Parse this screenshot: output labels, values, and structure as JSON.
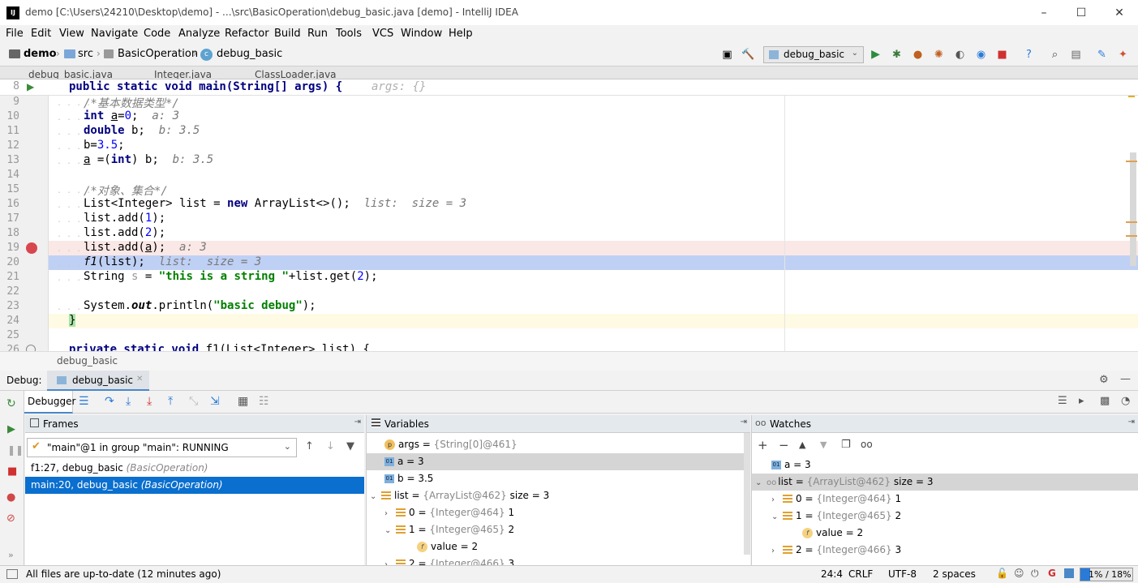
{
  "window": {
    "title": "demo [C:\\Users\\24210\\Desktop\\demo] - ...\\src\\BasicOperation\\debug_basic.java [demo] - IntelliJ IDEA"
  },
  "menu": [
    "File",
    "Edit",
    "View",
    "Navigate",
    "Code",
    "Analyze",
    "Refactor",
    "Build",
    "Run",
    "Tools",
    "VCS",
    "Window",
    "Help"
  ],
  "breadcrumb": [
    "demo",
    "src",
    "BasicOperation",
    "debug_basic"
  ],
  "run_config": "debug_basic",
  "tabs": [
    "debug_basic.java",
    "Integer.java",
    "ClassLoader.java"
  ],
  "editor": {
    "sticky_line_no": "8",
    "sticky_code": "public static void main(String[] args) {",
    "sticky_hint": "args: {}",
    "line_numbers": [
      "9",
      "10",
      "11",
      "12",
      "13",
      "14",
      "15",
      "16",
      "17",
      "18",
      "19",
      "20",
      "21",
      "22",
      "23",
      "24",
      "25",
      "26"
    ],
    "hints": {
      "l10": "a: 3",
      "l11": "b: 3.5",
      "l13": "b: 3.5",
      "l16": "list:  size = 3",
      "l19": "a: 3",
      "l20": "list:  size = 3"
    },
    "code": {
      "l9": "/*基本数据类型*/",
      "l15": "/*对象、集合*/",
      "l21_str": "\"this is a string \"",
      "l23_str": "\"basic debug\""
    },
    "status_crumb": "debug_basic"
  },
  "debug": {
    "label": "Debug:",
    "session_tab": "debug_basic",
    "debugger_tab": "Debugger",
    "frames_title": "Frames",
    "thread": "\"main\"@1 in group \"main\": RUNNING",
    "frames": [
      {
        "name": "f1:27, debug_basic",
        "cls": "(BasicOperation)"
      },
      {
        "name": "main:20, debug_basic",
        "cls": "(BasicOperation)"
      }
    ],
    "variables_title": "Variables",
    "variables": [
      {
        "name": "args",
        "eq": " = ",
        "ref": "{String[0]@461}",
        "val": ""
      },
      {
        "name": "a",
        "eq": " = ",
        "ref": "",
        "val": "3"
      },
      {
        "name": "b",
        "eq": " = ",
        "ref": "",
        "val": "3.5"
      },
      {
        "name": "list",
        "eq": " = ",
        "ref": "{ArrayList@462}",
        "val": "size = 3"
      },
      {
        "name": "0",
        "eq": " = ",
        "ref": "{Integer@464}",
        "val": "1"
      },
      {
        "name": "1",
        "eq": " = ",
        "ref": "{Integer@465}",
        "val": "2"
      },
      {
        "name": "value",
        "eq": " = ",
        "ref": "",
        "val": "2"
      },
      {
        "name": "2",
        "eq": " = ",
        "ref": "{Integer@466}",
        "val": "3"
      }
    ],
    "watches_title": "Watches",
    "watches": [
      {
        "name": "a",
        "eq": " = ",
        "ref": "",
        "val": "3"
      },
      {
        "name": "list",
        "eq": " = ",
        "ref": "{ArrayList@462}",
        "val": "size = 3"
      },
      {
        "name": "0",
        "eq": " = ",
        "ref": "{Integer@464}",
        "val": "1"
      },
      {
        "name": "1",
        "eq": " = ",
        "ref": "{Integer@465}",
        "val": "2"
      },
      {
        "name": "value",
        "eq": " = ",
        "ref": "",
        "val": "2"
      },
      {
        "name": "2",
        "eq": " = ",
        "ref": "{Integer@466}",
        "val": "3"
      }
    ]
  },
  "status": {
    "message": "All files are up-to-date (12 minutes ago)",
    "position": "24:4",
    "line_sep": "CRLF",
    "encoding": "UTF-8",
    "indent": "2 spaces",
    "memory": "1% / 18%"
  },
  "colors": {
    "selection": "#0a6fce",
    "exec_line": "#bfd0f5",
    "breakpoint_line": "#fae8e6",
    "caret_line": "#fffae3"
  }
}
